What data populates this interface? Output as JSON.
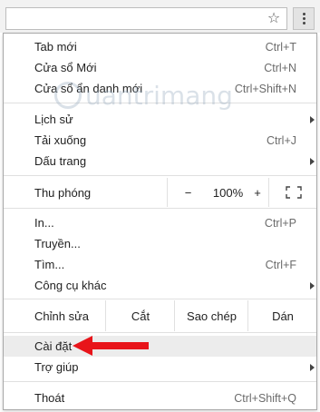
{
  "menu": {
    "items": [
      {
        "label": "Tab mới",
        "shortcut": "Ctrl+T"
      },
      {
        "label": "Cửa sổ Mới",
        "shortcut": "Ctrl+N"
      },
      {
        "label": "Cửa sổ ẩn danh mới",
        "shortcut": "Ctrl+Shift+N"
      },
      {
        "label": "Lịch sử"
      },
      {
        "label": "Tải xuống",
        "shortcut": "Ctrl+J"
      },
      {
        "label": "Dấu trang"
      },
      {
        "label": "In...",
        "shortcut": "Ctrl+P"
      },
      {
        "label": "Truyền..."
      },
      {
        "label": "Tìm...",
        "shortcut": "Ctrl+F"
      },
      {
        "label": "Công cụ khác"
      },
      {
        "label": "Cài đặt"
      },
      {
        "label": "Trợ giúp"
      },
      {
        "label": "Thoát",
        "shortcut": "Ctrl+Shift+Q"
      }
    ],
    "zoom": {
      "label": "Thu phóng",
      "minus": "−",
      "value": "100%",
      "plus": "+"
    },
    "edit": {
      "label": "Chỉnh sửa",
      "cut": "Cắt",
      "copy": "Sao chép",
      "paste": "Dán"
    }
  },
  "toolbar": {
    "star_icon": "☆"
  },
  "watermark": {
    "text": "uantrimang"
  },
  "colors": {
    "arrow": "#e8141a",
    "highlight": "#ececec"
  }
}
